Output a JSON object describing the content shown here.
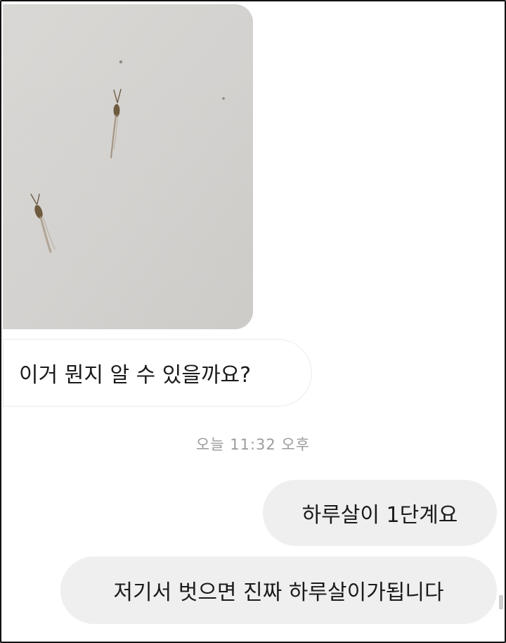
{
  "chat": {
    "messages": [
      {
        "sender": "other",
        "type": "image",
        "content": "photo-of-insects-on-wall"
      },
      {
        "sender": "other",
        "type": "text",
        "text": "이거 뭔지 알 수 있을까요?"
      },
      {
        "sender": "me",
        "type": "text",
        "text": "하루살이 1단계요"
      },
      {
        "sender": "me",
        "type": "text",
        "text": "저기서 벗으면 진짜 하루살이가됩니다"
      }
    ],
    "timestamp": "오늘 11:32 오후"
  },
  "colors": {
    "outgoing_bubble": "#efefef",
    "incoming_bubble": "#ffffff",
    "timestamp_text": "#9b9b9b",
    "wall_photo": "#d7d5d2"
  }
}
